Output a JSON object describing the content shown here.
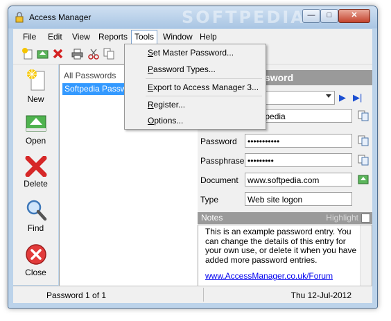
{
  "window": {
    "title": "Access Manager",
    "watermark": "SOFTPEDIA",
    "controls": {
      "minimize": "—",
      "maximize": "□",
      "close": "✕"
    }
  },
  "menubar": {
    "items": [
      "File",
      "Edit",
      "View",
      "Reports",
      "Tools",
      "Window",
      "Help"
    ],
    "active": "Tools"
  },
  "tools_menu": {
    "items": [
      {
        "pre": "",
        "key": "S",
        "rest": "et Master Password..."
      },
      {
        "pre": "",
        "key": "P",
        "rest": "assword Types..."
      },
      {
        "pre": "",
        "key": "E",
        "rest": "xport to Access Manager 3..."
      },
      {
        "pre": "",
        "key": "R",
        "rest": "egister..."
      },
      {
        "pre": "",
        "key": "O",
        "rest": "ptions..."
      }
    ]
  },
  "toolbar": {
    "icons": [
      "new-icon",
      "open-icon",
      "delete-icon",
      "print-icon",
      "cut-icon",
      "copy-icon"
    ]
  },
  "sidebar": {
    "new": "New",
    "open": "Open",
    "delete": "Delete",
    "find": "Find",
    "close": "Close"
  },
  "list": {
    "header": "All Passwords",
    "rows": [
      "Softpedia Password"
    ]
  },
  "detail": {
    "header": "Password",
    "username_value": "Softpedia",
    "password_label": "Password",
    "password_value": "•••••••••••",
    "passphrase_label": "Passphrase",
    "passphrase_value": "•••••••••",
    "document_label": "Document",
    "document_value": "www.softpedia.com",
    "type_label": "Type",
    "type_value": "Web site logon",
    "notes_label": "Notes",
    "highlight_label": "Highlight",
    "notes_text": "This is an example password entry.  You can change the details of this entry for your own use, or delete it when you have added more password entries.",
    "notes_link": "www.AccessManager.co.uk/Forum"
  },
  "status": {
    "position": "Password 1 of 1",
    "date": "Thu 12-Jul-2012"
  },
  "colors": {
    "selection": "#3399ff",
    "header_gray": "#9a9a9a",
    "link": "#0000ee",
    "title_gradient": "#a9c5e3"
  }
}
